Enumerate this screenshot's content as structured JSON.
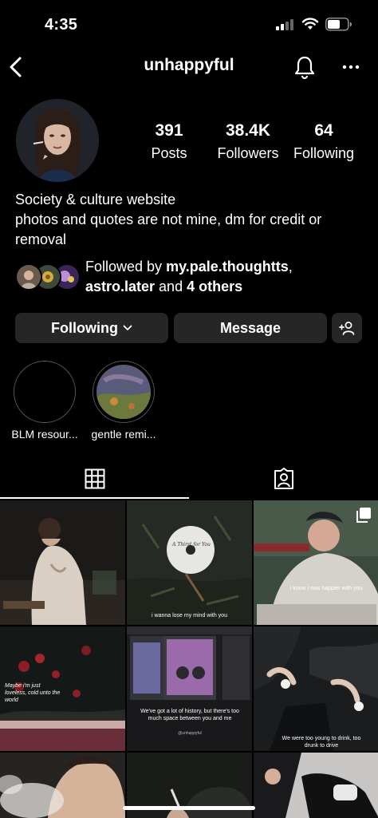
{
  "status_bar": {
    "time": "4:35"
  },
  "nav": {
    "username": "unhappyful",
    "back_icon": "chevron-left-icon",
    "notify_icon": "bell-icon",
    "more_icon": "ellipsis-icon"
  },
  "profile": {
    "stats": [
      {
        "value": "391",
        "label": "Posts"
      },
      {
        "value": "38.4K",
        "label": "Followers"
      },
      {
        "value": "64",
        "label": "Following"
      }
    ],
    "bio": [
      "Society & culture website",
      "photos and quotes are not mine, dm for credit or removal"
    ],
    "followed_by": {
      "prefix": "Followed by ",
      "user1": "my.pale.thoughtts",
      "sep": ",",
      "user2": "astro.later",
      "mid": " and ",
      "others": "4 others"
    }
  },
  "actions": {
    "following_label": "Following",
    "message_label": "Message",
    "add_icon": "add-person-icon"
  },
  "highlights": [
    {
      "label": "BLM resour..."
    },
    {
      "label": "gentle remi..."
    }
  ],
  "tabs": [
    {
      "name": "posts",
      "icon": "grid-icon",
      "active": true
    },
    {
      "name": "tagged",
      "icon": "tagged-person-icon",
      "active": false
    }
  ],
  "grid": {
    "captions": {
      "tile2": "i wanna lose my mind with you",
      "tile3": "i know i was happier with you",
      "tile4": "Maybe i'm just loveless, cold unto the world",
      "tile5": "We've got a lot of history, but there's too much space between you and me",
      "tile5_handle": "@unhappyful",
      "tile6": "We were too young to drink, too drunk to drive"
    },
    "disc_text": "A Thirst for You",
    "multi_icon": "multiple-posts-icon"
  },
  "colors": {
    "button_bg": "#262626",
    "background": "#000000",
    "text": "#ffffff"
  }
}
